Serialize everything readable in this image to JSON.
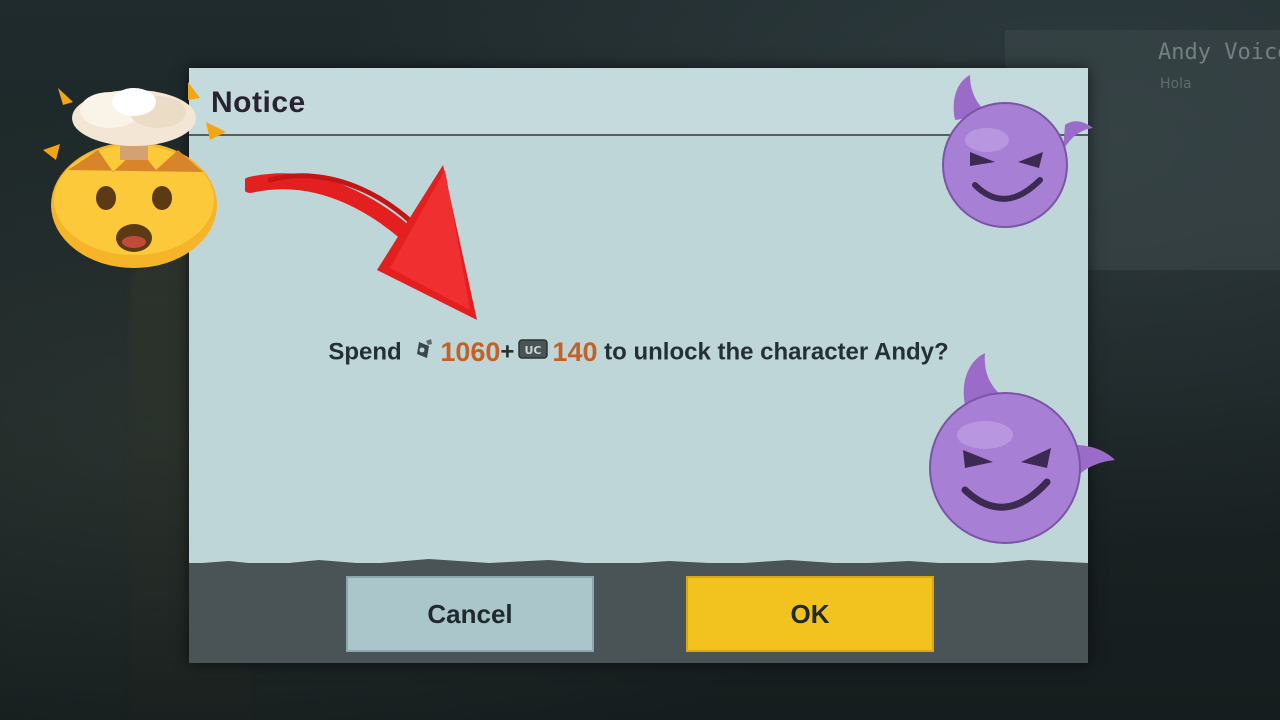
{
  "background": {
    "title": "Andy Voice",
    "subtitle": "Hola"
  },
  "dialog": {
    "title": "Notice",
    "message": {
      "prefix": "Spend",
      "amount_1": "1060",
      "separator": "+",
      "currency_2_label": "UC",
      "amount_2": "140",
      "suffix": "to unlock the character Andy?"
    },
    "buttons": {
      "cancel_label": "Cancel",
      "ok_label": "OK"
    }
  },
  "overlays": {
    "arrow_icon": "red-arrow-icon",
    "left_emoji": "exploding-head-emoji-icon",
    "right_emojis": [
      "smiling-devil-emoji-icon",
      "smiling-devil-emoji-icon"
    ]
  },
  "colors": {
    "dialog_bg": "#bfd6d9",
    "ok_button": "#f2c21e",
    "cancel_button": "#abc6ca",
    "price_text": "#c0622a",
    "arrow": "#e41f1f"
  }
}
